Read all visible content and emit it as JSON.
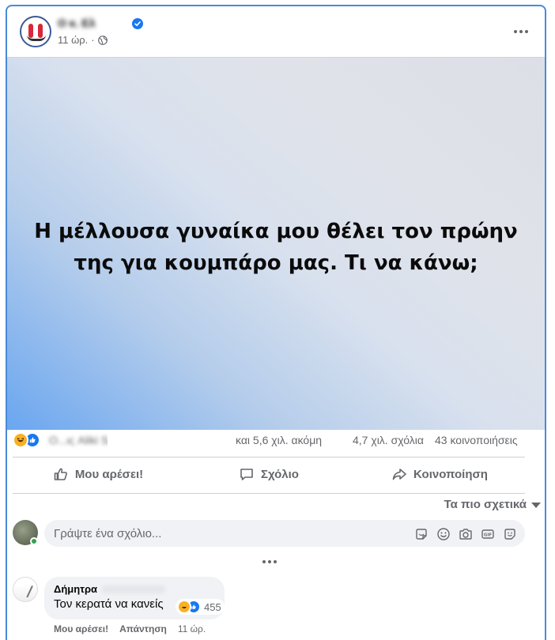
{
  "post": {
    "page_name": "Ο κ. Ελ",
    "time_ago": "11 ώρ.",
    "separator": "·",
    "image_text_line1": "Η μέλλουσα γυναίκα μου θέλει τον πρώην",
    "image_text_line2": "της για κουμπάρο μας. Τι να κάνω;"
  },
  "reactions": {
    "icons": [
      "haha-icon",
      "like-icon"
    ],
    "names": "Ο...ις Aliki Sa... Ιση",
    "more": "και 5,6 χιλ. ακόμη",
    "comments": "4,7 χιλ. σχόλια",
    "shares": "43 κοινοποιήσεις"
  },
  "actions": {
    "like": "Μου αρέσει!",
    "comment": "Σχόλιο",
    "share": "Κοινοποίηση"
  },
  "sort": {
    "label": "Τα πιο σχετικά"
  },
  "composer": {
    "placeholder": "Γράψτε ένα σχόλιο...",
    "tools": [
      "sticker-icon",
      "emoji-icon",
      "camera-icon",
      "gif-icon",
      "avatar-sticker-icon"
    ]
  },
  "comment": {
    "author": "Δήμητρα",
    "text": "Τον κερατά να κανείς",
    "reaction_count": "455",
    "like_action": "Μου αρέσει!",
    "reply_action": "Απάντηση",
    "time": "11 ώρ."
  },
  "colors": {
    "accent": "#1877f2",
    "border": "#4a8ad8",
    "secondary_text": "#65676b"
  }
}
